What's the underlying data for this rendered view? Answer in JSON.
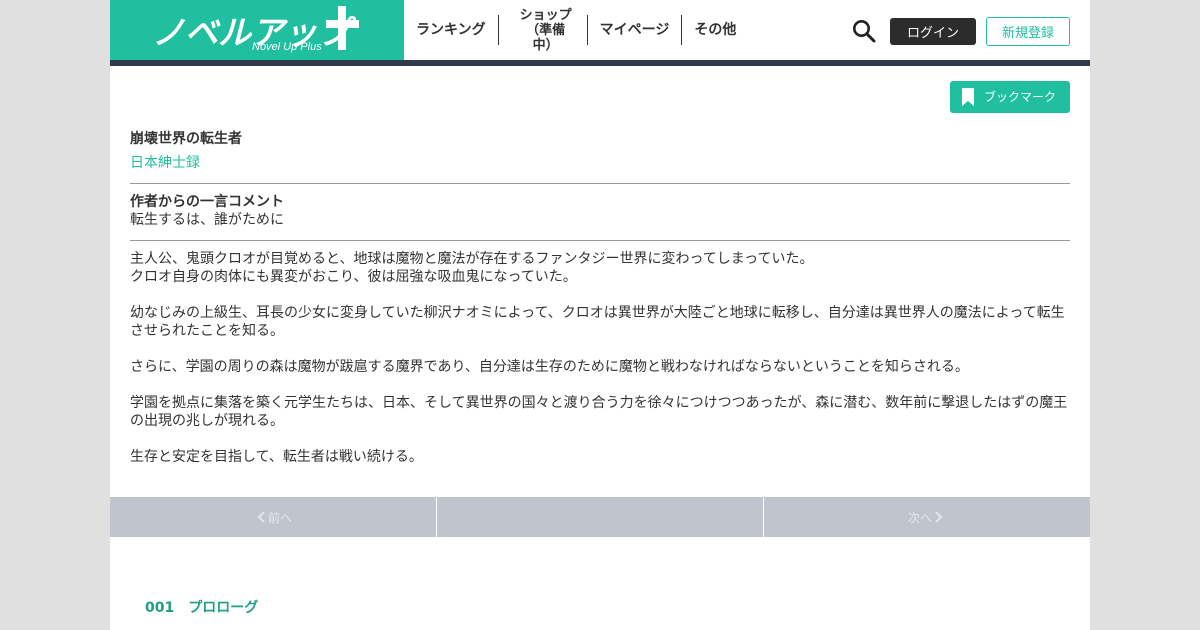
{
  "header": {
    "logo": {
      "main": "ノベルアップ",
      "sub": "Novel Up Plus"
    },
    "nav": [
      {
        "label": "ランキング"
      },
      {
        "label": "ショップ\n（準備中）"
      },
      {
        "label": "マイページ"
      },
      {
        "label": "その他"
      }
    ],
    "login_label": "ログイン",
    "register_label": "新規登録"
  },
  "work": {
    "bookmark_label": "ブックマーク",
    "title": "崩壊世界の転生者",
    "author": "日本紳士録",
    "comment_heading": "作者からの一言コメント",
    "comment": "転生するは、誰がために",
    "synopsis": [
      "主人公、鬼頭クロオが目覚めると、地球は魔物と魔法が存在するファンタジー世界に変わってしまっていた。",
      "クロオ自身の肉体にも異変がおこり、彼は屈強な吸血鬼になっていた。",
      "幼なじみの上級生、耳長の少女に変身していた柳沢ナオミによって、クロオは異世界が大陸ごと地球に転移し、自分達は異世界人の魔法によって転生させられたことを知る。",
      "さらに、学園の周りの森は魔物が跋扈する魔界であり、自分達は生存のために魔物と戦わなければならないということを知らされる。",
      "学園を拠点に集落を築く元学生たちは、日本、そして異世界の国々と渡り合う力を徐々につけつつあったが、森に潜む、数年前に撃退したはずの魔王の出現の兆しが現れる。",
      "生存と安定を目指して、転生者は戦い続ける。"
    ]
  },
  "pager": {
    "prev_label": "前へ",
    "next_label": "次へ"
  },
  "chapters": [
    {
      "number": "001",
      "title": "プロローグ"
    }
  ],
  "colors": {
    "accent": "#1fbf9f",
    "header_bar": "#2f3a4b",
    "pager_bg": "#bec5cc",
    "background": "#e0e0e0"
  },
  "icons": {
    "search": "search-icon",
    "bookmark": "bookmark-icon",
    "prev": "chevron-left-icon",
    "next": "chevron-right-icon"
  }
}
